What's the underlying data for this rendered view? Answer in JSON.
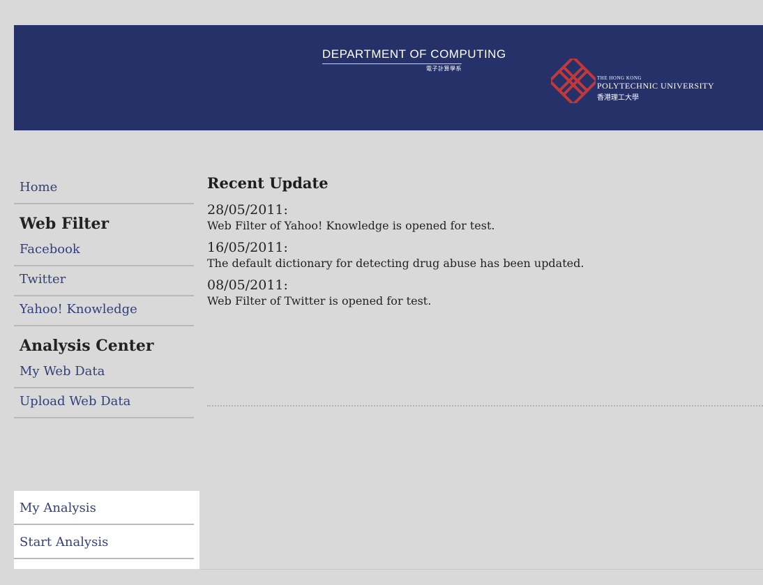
{
  "banner": {
    "department": "DEPARTMENT OF COMPUTING",
    "department_chinese": "電子計算學系",
    "university_small": "THE HONG KONG",
    "university_name": "POLYTECHNIC UNIVERSITY",
    "university_chinese": "香港理工大學",
    "colors": {
      "background": "#253168",
      "logo": "#c0393a"
    }
  },
  "sidebar": {
    "home": "Home",
    "web_filter_heading": "Web Filter",
    "web_filter_items": [
      "Facebook",
      "Twitter",
      "Yahoo! Knowledge"
    ],
    "analysis_heading": "Analysis Center",
    "analysis_items": [
      "My Web Data",
      "Upload Web Data"
    ],
    "analysis_box_items": [
      "My Analysis",
      "Start Analysis"
    ]
  },
  "main": {
    "title": "Recent Update",
    "updates": [
      {
        "date": "28/05/2011:",
        "text": "Web Filter of Yahoo! Knowledge is opened for test."
      },
      {
        "date": "16/05/2011:",
        "text": "The default dictionary for detecting drug abuse has been updated."
      },
      {
        "date": "08/05/2011:",
        "text": "Web Filter of Twitter is opened for test."
      }
    ]
  }
}
